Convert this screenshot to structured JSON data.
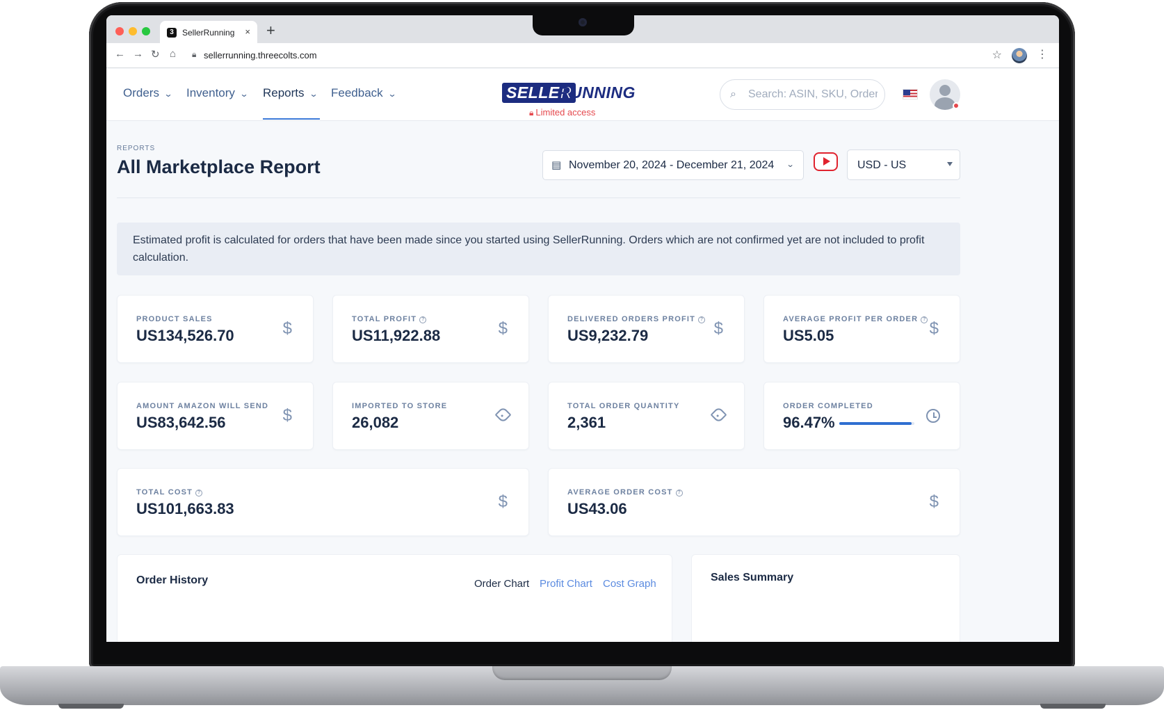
{
  "browser": {
    "tab_title": "SellerRunning",
    "tab_favicon": "3",
    "tab_close": "×",
    "new_tab": "+",
    "url": "sellerrunning.threecolts.com"
  },
  "header": {
    "nav": [
      {
        "label": "Orders"
      },
      {
        "label": "Inventory"
      },
      {
        "label": "Reports",
        "active": true
      },
      {
        "label": "Feedback"
      }
    ],
    "logo_seller": "SELLER",
    "logo_running": "RUNNING",
    "access_note": "Limited access",
    "search_placeholder": "Search: ASIN, SKU, Order",
    "country": "US"
  },
  "page": {
    "breadcrumb": "REPORTS",
    "title": "All Marketplace Report",
    "date_range": "November 20, 2024 - December 21, 2024",
    "currency": "USD - US",
    "notice": "Estimated profit is calculated for orders that have been made since you started using SellerRunning. Orders which are not confirmed yet are not included to profit calculation."
  },
  "stats": {
    "product_sales": {
      "label": "PRODUCT SALES",
      "value": "US134,526.70",
      "icon": "dollar-icon"
    },
    "total_profit": {
      "label": "TOTAL PROFIT",
      "value": "US11,922.88",
      "icon": "dollar-icon"
    },
    "delivered_orders_profit": {
      "label": "DELIVERED ORDERS PROFIT",
      "value": "US9,232.79",
      "icon": "dollar-icon"
    },
    "average_profit_per_order": {
      "label": "AVERAGE PROFIT PER ORDER",
      "value": "US5.05",
      "icon": "dollar-icon"
    },
    "amount_amazon_will_send": {
      "label": "AMOUNT AMAZON WILL SEND",
      "value": "US83,642.56",
      "icon": "dollar-icon"
    },
    "imported_to_store": {
      "label": "IMPORTED TO STORE",
      "value": "26,082",
      "icon": "tag-icon"
    },
    "total_order_quantity": {
      "label": "TOTAL ORDER QUANTITY",
      "value": "2,361",
      "icon": "tag-icon"
    },
    "order_completed": {
      "label": "ORDER COMPLETED",
      "value": "96.47%",
      "progress": 0.9647,
      "icon": "clock-icon"
    },
    "total_cost": {
      "label": "TOTAL COST",
      "value": "US101,663.83",
      "icon": "dollar-icon"
    },
    "average_order_cost": {
      "label": "AVERAGE ORDER COST",
      "value": "US43.06",
      "icon": "dollar-icon"
    }
  },
  "order_history": {
    "title": "Order History",
    "tabs": [
      "Order Chart",
      "Profit Chart",
      "Cost Graph"
    ],
    "active_tab": "Order Chart"
  },
  "sales_summary": {
    "title": "Sales Summary"
  },
  "colors": {
    "accent": "#3c7ad8",
    "brand": "#1c2c80",
    "alert": "#e5484d",
    "text": "#1b2a44"
  }
}
